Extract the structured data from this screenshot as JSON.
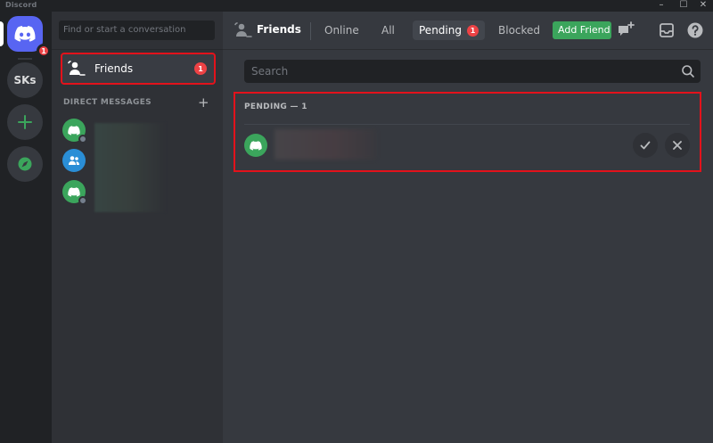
{
  "window": {
    "title": "Discord",
    "controls": [
      "–",
      "☐",
      "✕"
    ]
  },
  "rail": {
    "home_badge": "1",
    "server_label": "SKs",
    "add_symbol": "+"
  },
  "sidebar": {
    "search_placeholder": "Find or start a conversation",
    "friends_label": "Friends",
    "friends_badge": "1",
    "dm_header": "DIRECT MESSAGES",
    "dm_add_symbol": "+"
  },
  "topbar": {
    "title": "Friends",
    "tabs": [
      {
        "label": "Online"
      },
      {
        "label": "All"
      },
      {
        "label": "Pending",
        "badge": "1"
      },
      {
        "label": "Blocked"
      }
    ],
    "add_friend_label": "Add Friend"
  },
  "main": {
    "search_placeholder": "Search",
    "pending_header": "PENDING — 1"
  },
  "colors": {
    "brand": "#5865f2",
    "green": "#3ba55c",
    "red_badge": "#ed4245",
    "highlight_border": "#e3121b"
  },
  "icons": {
    "home": "discord-logo-icon",
    "add_server": "plus-icon",
    "explore": "compass-icon",
    "friends": "friends-wave-icon",
    "new_group": "new-group-dm-icon",
    "inbox": "inbox-icon",
    "help": "help-icon",
    "search": "search-icon",
    "accept": "check-icon",
    "decline": "close-icon"
  }
}
